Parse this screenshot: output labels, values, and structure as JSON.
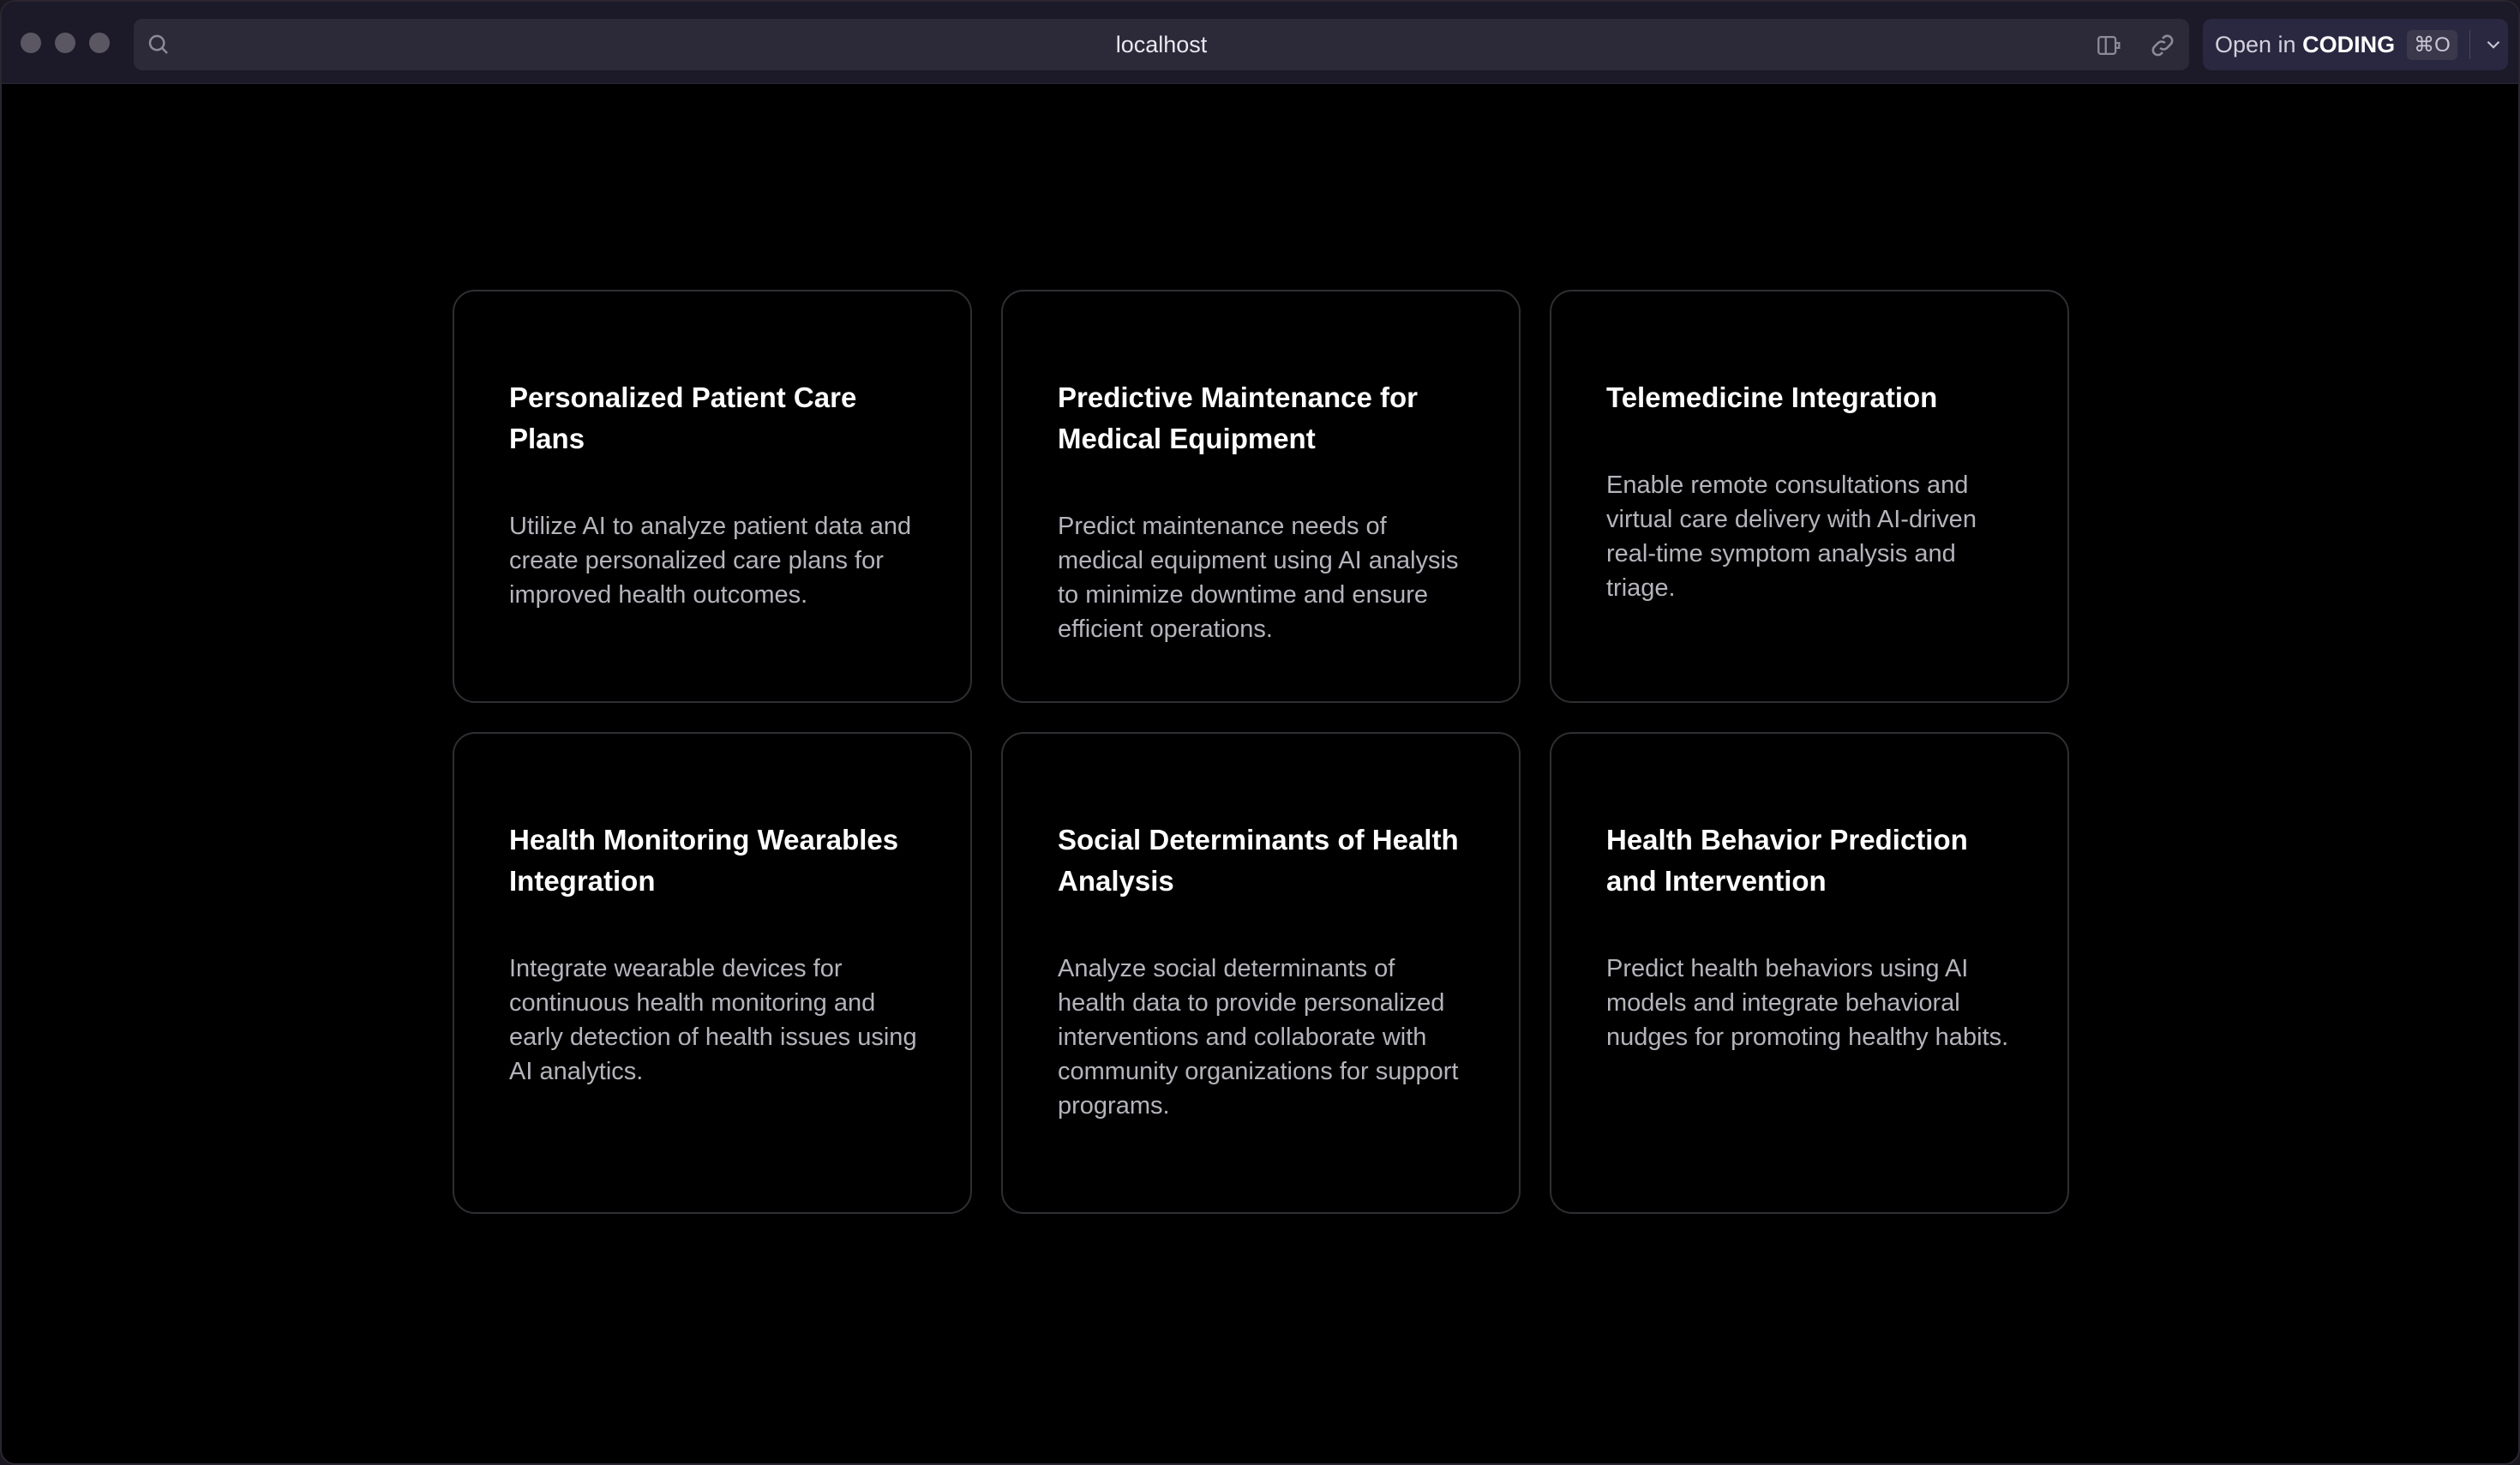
{
  "browser": {
    "url": "localhost",
    "open_in": {
      "prefix": "Open in",
      "app": "CODING",
      "shortcut": "⌘O"
    }
  },
  "cards": [
    {
      "title": "Personalized Patient Care Plans",
      "description": "Utilize AI to analyze patient data and create personalized care plans for improved health outcomes."
    },
    {
      "title": "Predictive Maintenance for Medical Equipment",
      "description": "Predict maintenance needs of medical equipment using AI analysis to minimize downtime and ensure efficient operations."
    },
    {
      "title": "Telemedicine Integration",
      "description": "Enable remote consultations and virtual care delivery with AI-driven real-time symptom analysis and triage."
    },
    {
      "title": "Health Monitoring Wearables Integration",
      "description": "Integrate wearable devices for continuous health monitoring and early detection of health issues using AI analytics."
    },
    {
      "title": "Social Determinants of Health Analysis",
      "description": "Analyze social determinants of health data to provide personalized interventions and collaborate with community organizations for support programs."
    },
    {
      "title": "Health Behavior Prediction and Intervention",
      "description": "Predict health behaviors using AI models and integrate behavioral nudges for promoting healthy habits."
    }
  ],
  "colors": {
    "background": "#000000",
    "card_border": "#2f2f33",
    "title": "#ffffff",
    "description": "#b4b4bb"
  }
}
